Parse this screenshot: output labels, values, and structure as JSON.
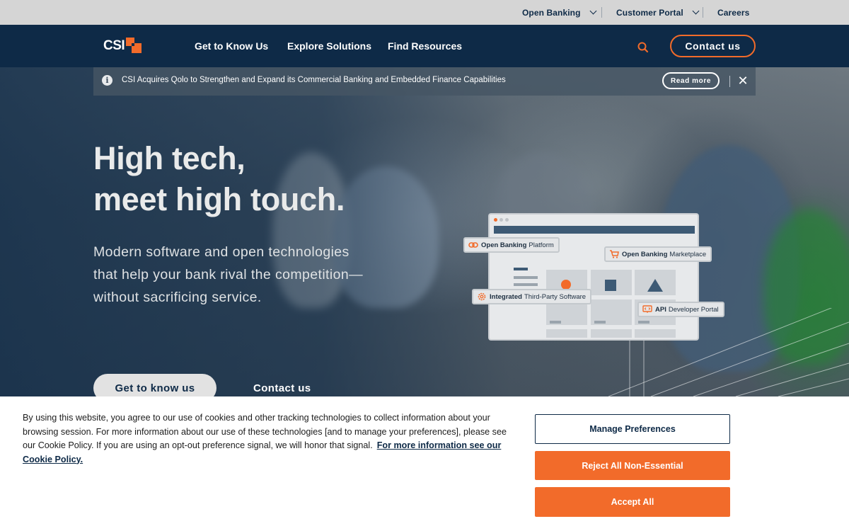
{
  "utility_nav": {
    "open_banking": "Open Banking",
    "customer_portal": "Customer Portal",
    "careers": "Careers"
  },
  "main_nav": {
    "logo_text": "CSI",
    "links": [
      "Get to Know Us",
      "Explore Solutions",
      "Find Resources"
    ],
    "search_icon": "search-icon",
    "contact_label": "Contact us"
  },
  "announcement": {
    "info_icon": "info-icon",
    "info_glyph": "i",
    "text": "CSI Acquires Qolo to Strengthen and Expand its Commercial Banking and Embedded Finance Capabilities",
    "read_more": "Read more",
    "close_glyph": "✕"
  },
  "hero": {
    "headline_line1": "High tech,",
    "headline_line2": "meet high touch.",
    "subtext": "Modern software and open technologies that help your bank rival the competition—without sacrificing service.",
    "cta_primary": "Get to know us",
    "cta_secondary": "Contact us"
  },
  "illustration": {
    "pills": {
      "platform_bold": "Open Banking",
      "platform_rest": "Platform",
      "marketplace_bold": "Open Banking",
      "marketplace_rest": "Marketplace",
      "thirdparty_bold": "Integrated",
      "thirdparty_rest": "Third-Party Software",
      "api_bold": "API",
      "api_rest": "Developer Portal"
    }
  },
  "cookie_banner": {
    "text": "By using this website, you agree to our use of cookies and other tracking technologies to collect information about your browsing session. For more information about our use of these technologies [and to manage your preferences], please see our Cookie Policy. If you are using an opt-out preference signal, we will honor that signal.",
    "link": "For more information see our Cookie Policy.",
    "manage": "Manage Preferences",
    "reject": "Reject All Non-Essential",
    "accept": "Accept All"
  },
  "colors": {
    "navy": "#0e2a47",
    "orange": "#f26b2a",
    "utility_bg": "#d5d5d5"
  }
}
